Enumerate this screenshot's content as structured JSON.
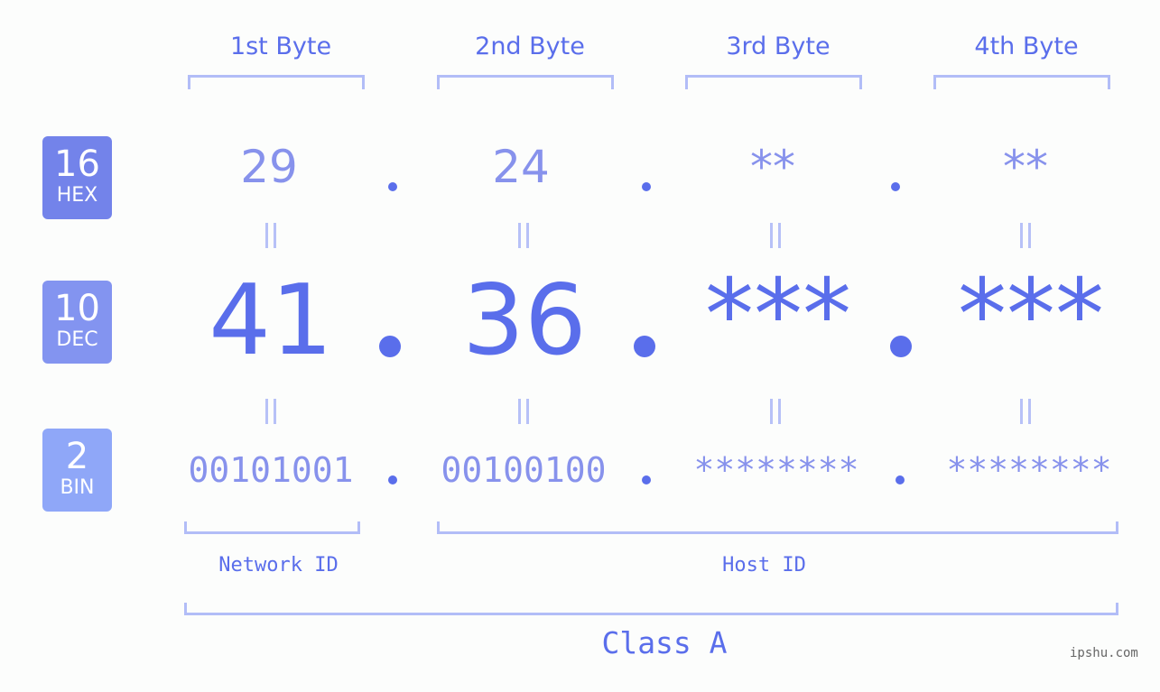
{
  "bases": [
    {
      "num": "16",
      "label": "HEX",
      "color": "#7383EA"
    },
    {
      "num": "10",
      "label": "DEC",
      "color": "#8394F0"
    },
    {
      "num": "2",
      "label": "BIN",
      "color": "#8FA7F8"
    }
  ],
  "byte_headers": [
    "1st Byte",
    "2nd Byte",
    "3rd Byte",
    "4th Byte"
  ],
  "hex": [
    "29",
    "24",
    "**",
    "**"
  ],
  "dec": [
    "41",
    "36",
    "***",
    "***"
  ],
  "bin": [
    "00101001",
    "00100100",
    "********",
    "********"
  ],
  "separator": ".",
  "network_label": "Network ID",
  "host_label": "Host ID",
  "class_label": "Class A",
  "watermark": "ipshu.com",
  "colors": {
    "primary": "#5A6EEB",
    "secondary": "#8792EC",
    "bracket": "#B2BDF7"
  }
}
